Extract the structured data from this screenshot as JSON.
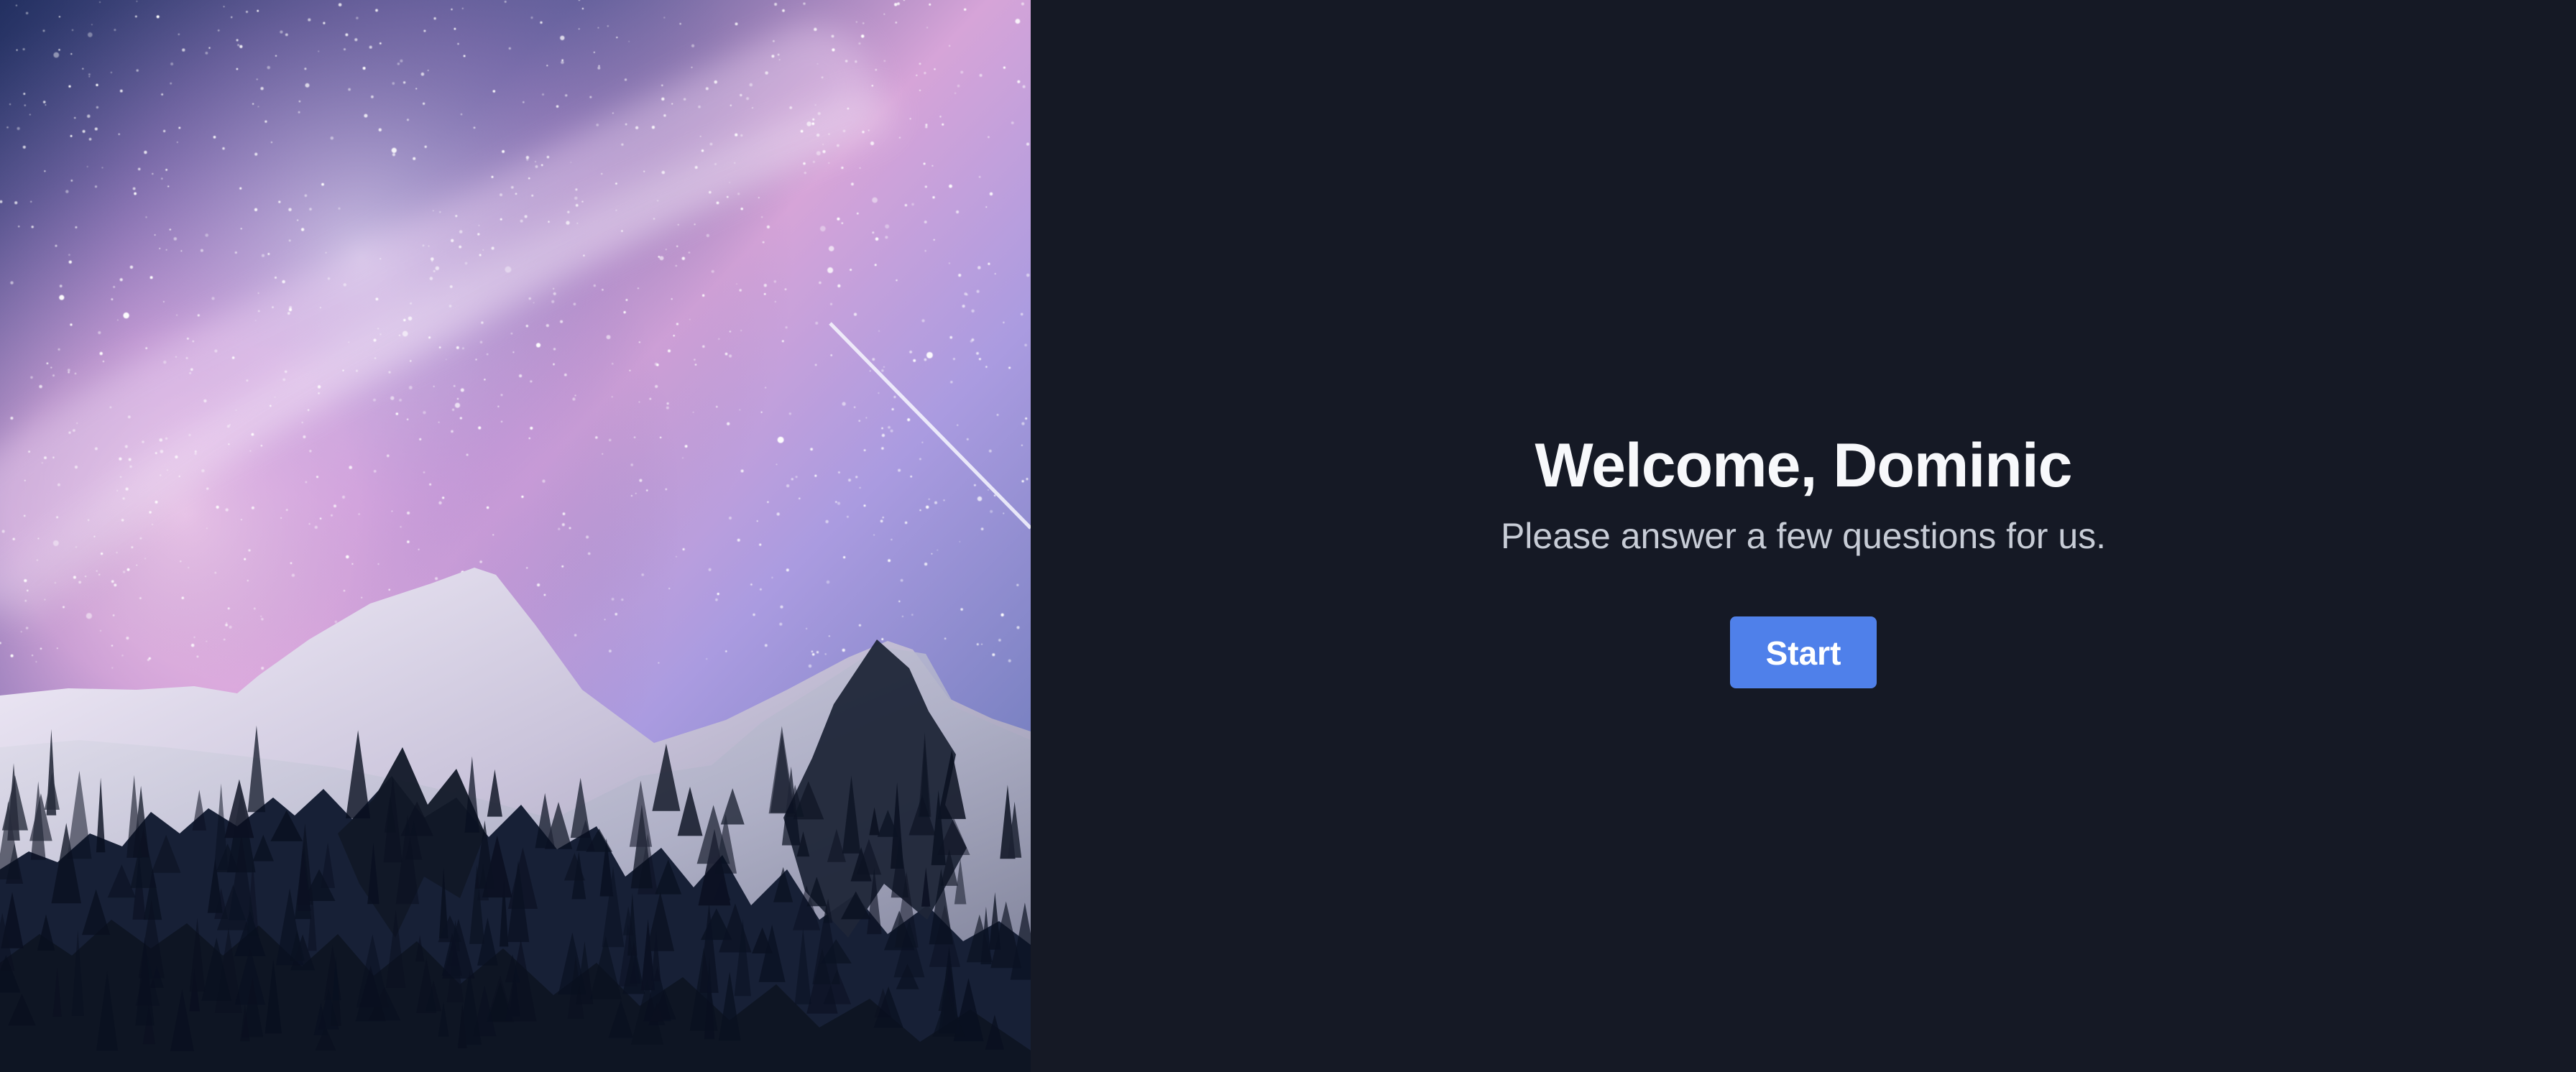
{
  "hero": {
    "image_name": "mountain-night-sky-image"
  },
  "welcome": {
    "title": "Welcome, Dominic",
    "subtitle": "Please answer a few questions for us.",
    "start_label": "Start"
  },
  "colors": {
    "panel_background": "#151925",
    "title_text": "#f7f8fb",
    "subtitle_text": "#c7ccd6",
    "button_background": "#4f80ea",
    "button_text": "#ffffff"
  }
}
